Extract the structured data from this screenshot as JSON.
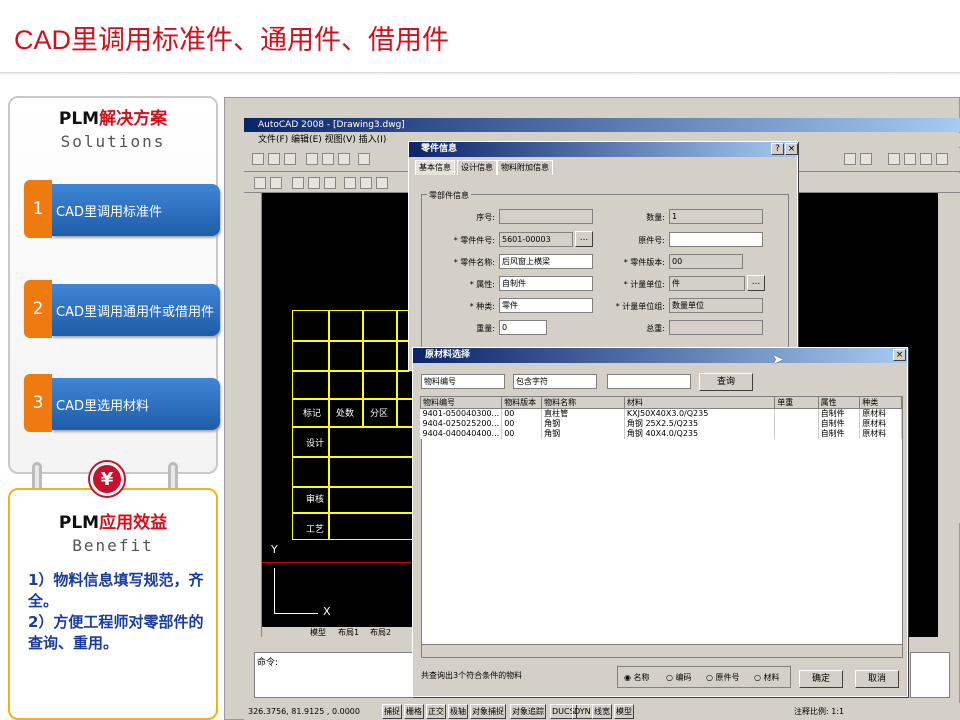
{
  "page": {
    "title": "CAD里调用标准件、通用件、借用件"
  },
  "solutions": {
    "title_black": "PLM",
    "title_red": "解决方案",
    "subtitle": "Solutions",
    "steps": [
      {
        "num": "1",
        "label": "CAD里调用标准件"
      },
      {
        "num": "2",
        "label": "CAD里调用通用件或借用件"
      },
      {
        "num": "3",
        "label": "CAD里选用材料"
      }
    ]
  },
  "benefit": {
    "title_black": "PLM",
    "title_red": "应用效益",
    "subtitle": "Benefit",
    "coin_symbol": "¥",
    "line1": "1）物料信息填写规范，齐全。",
    "line2": "2）方便工程师对零部件的查询、重用。"
  },
  "acad": {
    "title": "AutoCAD 2008 - [Drawing3.dwg]",
    "menu": "文件(F)  编辑(E)  视图(V)  插入(I)",
    "cmd": "命令:",
    "coords": "326.3756, 81.9125 , 0.0000",
    "status_buttons": [
      "捕捉",
      "栅格",
      "正交",
      "极轴",
      "对象捕捉",
      "对象追踪",
      "DUCS",
      "DYN",
      "线宽",
      "模型"
    ],
    "scale": "注释比例: 1:1",
    "tabs": [
      "模型",
      "布局1",
      "布局2"
    ],
    "axis_y": "Y",
    "axis_x": "X",
    "table_texts": [
      "标记",
      "处数",
      "分区",
      "设计",
      "审核",
      "工艺"
    ]
  },
  "part_dialog": {
    "title": "零件信息",
    "help": "?",
    "tabs": [
      "基本信息",
      "设计信息",
      "物料附加信息"
    ],
    "group": "零部件信息",
    "fields": [
      {
        "label": "序号:",
        "value": ""
      },
      {
        "label": "数量:",
        "value": "1"
      },
      {
        "label": "* 零件件号:",
        "value": "5601-00003"
      },
      {
        "label": "原件号:",
        "value": ""
      },
      {
        "label": "* 零件名称:",
        "value": "后风窗上横梁"
      },
      {
        "label": "* 零件版本:",
        "value": "00"
      },
      {
        "label": "* 属性:",
        "value": "自制件"
      },
      {
        "label": "* 计量单位:",
        "value": "件"
      },
      {
        "label": "* 种类:",
        "value": "零件"
      },
      {
        "label": "* 计量单位组:",
        "value": "数量单位"
      },
      {
        "label": "重量:",
        "value": "0"
      },
      {
        "label": "总重:",
        "value": ""
      }
    ],
    "browse": "..."
  },
  "material_dialog": {
    "title": "原材料选择",
    "filter_field": "物料编号",
    "filter_op": "包含字符",
    "filter_value": "",
    "query": "查询",
    "columns": [
      "物料编号",
      "物料版本",
      "物料名称",
      "材料",
      "单重",
      "属性",
      "种类"
    ],
    "rows": [
      [
        "9401-050040300...",
        "00",
        "直柱管",
        "KXJ50X40X3.0/Q235",
        "",
        "自制件",
        "原材料"
      ],
      [
        "9404-025025200...",
        "00",
        "角钢",
        "角钢 25X2.5/Q235",
        "",
        "自制件",
        "原材料"
      ],
      [
        "9404-040040400...",
        "00",
        "角钢",
        "角钢 40X4.0/Q235",
        "",
        "自制件",
        "原材料"
      ]
    ],
    "result": "共查询出3个符合条件的物料",
    "radios": [
      "名称",
      "编码",
      "原件号",
      "材料"
    ],
    "ok": "确定",
    "cancel": "取消"
  },
  "colors": {
    "accent_red": "#d3101c",
    "step_orange": "#ef7b10",
    "step_blue": "#2a6fc0",
    "benefit_blue": "#1a3c9e",
    "benefit_border": "#f0b410"
  }
}
